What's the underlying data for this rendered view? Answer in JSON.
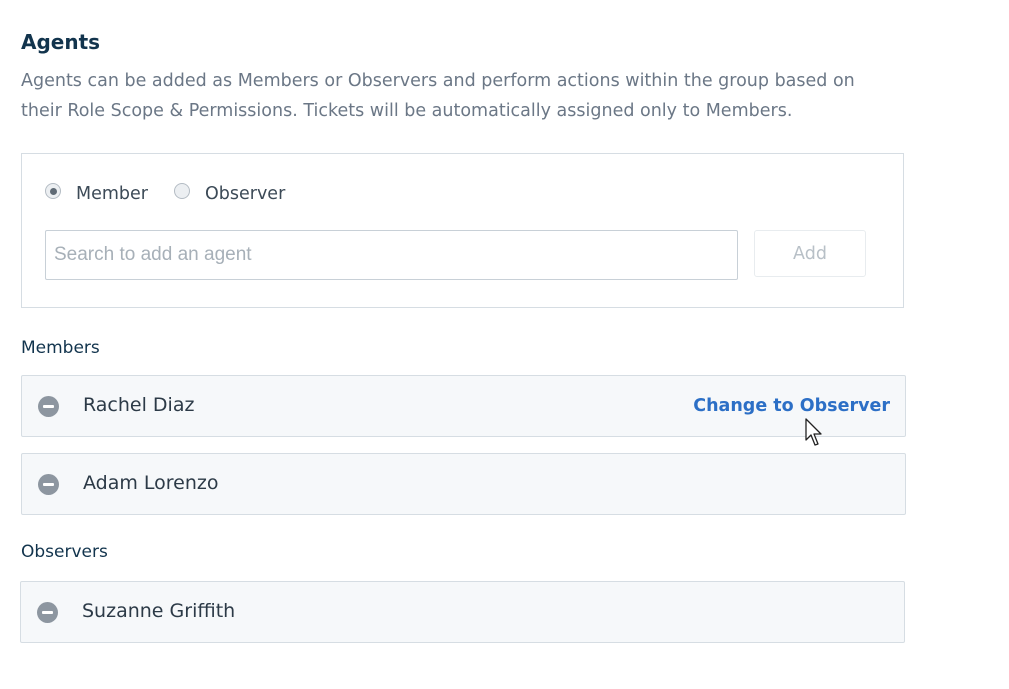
{
  "agents": {
    "title": "Agents",
    "description": "Agents can be added as Members or Observers and perform actions within the group based on their Role Scope & Permissions. Tickets will be automatically assigned only to Members.",
    "role_options": [
      {
        "label": "Member",
        "checked": true
      },
      {
        "label": "Observer",
        "checked": false
      }
    ],
    "search": {
      "placeholder": "Search to add an agent",
      "value": ""
    },
    "add_label": "Add",
    "members_heading": "Members",
    "members": [
      {
        "name": "Rachel Diaz",
        "action": "Change to Observer"
      },
      {
        "name": "Adam Lorenzo",
        "action": ""
      }
    ],
    "observers_heading": "Observers",
    "observers": [
      {
        "name": "Suzanne Griffith",
        "action": ""
      }
    ]
  },
  "colors": {
    "link": "#2c6fc6",
    "row_background": "#f6f8fa",
    "border": "#d6dde3",
    "remove_icon": "#8d96a0"
  },
  "icons": {
    "remove": "remove-circle-icon",
    "cursor": "mouse-pointer-icon"
  }
}
